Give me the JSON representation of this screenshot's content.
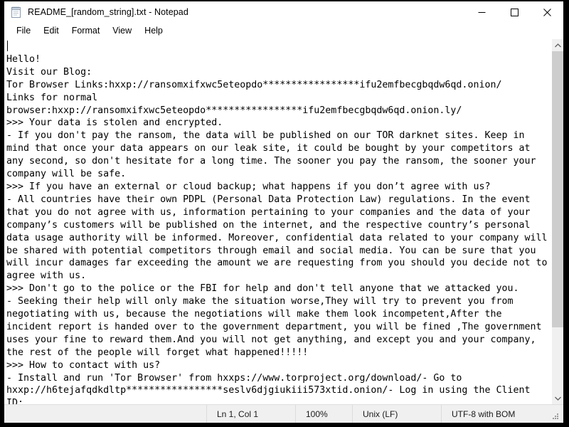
{
  "window": {
    "title": "README_[random_string].txt - Notepad",
    "icon": "notepad-icon",
    "controls": {
      "minimize": "minimize-icon",
      "maximize": "maximize-icon",
      "close": "close-icon"
    }
  },
  "menu": {
    "items": [
      {
        "label": "File"
      },
      {
        "label": "Edit"
      },
      {
        "label": "Format"
      },
      {
        "label": "View"
      },
      {
        "label": "Help"
      }
    ]
  },
  "editor": {
    "content": "\nHello!\nVisit our Blog:\nTor Browser Links:hxxp://ransomxifxwc5eteopdo*****************ifu2emfbecgbqdw6qd.onion/\nLinks for normal browser:hxxp://ransomxifxwc5eteopdo*****************ifu2emfbecgbqdw6qd.onion.ly/\n>>> Your data is stolen and encrypted.\n- If you don't pay the ransom, the data will be published on our TOR darknet sites. Keep in mind that once your data appears on our leak site, it could be bought by your competitors at any second, so don't hesitate for a long time. The sooner you pay the ransom, the sooner your company will be safe.\n>>> If you have an external or cloud backup; what happens if you don’t agree with us?\n- All countries have their own PDPL (Personal Data Protection Law) regulations. In the event that you do not agree with us, information pertaining to your companies and the data of your company’s customers will be published on the internet, and the respective country’s personal data usage authority will be informed. Moreover, confidential data related to your company will be shared with potential competitors through email and social media. You can be sure that you will incur damages far exceeding the amount we are requesting from you should you decide not to agree with us.\n>>> Don't go to the police or the FBI for help and don't tell anyone that we attacked you.\n- Seeking their help will only make the situation worse,They will try to prevent you from negotiating with us, because the negotiations will make them look incompetent,After the incident report is handed over to the government department, you will be fined ,The government uses your fine to reward them.And you will not get anything, and except you and your company, the rest of the people will forget what happened!!!!!\n>>> How to contact with us?\n- Install and run 'Tor Browser' from hxxps://www.torproject.org/download/- Go to hxxp://h6tejafqdkdltp*****************seslv6djgiukiii573xtid.onion/- Log in using the Client ID:\n-"
  },
  "scrollbar": {
    "up_arrow": "chevron-up-icon",
    "down_arrow": "chevron-down-icon",
    "thumb_position_percent": 0,
    "thumb_size_percent": 81
  },
  "statusbar": {
    "position": "Ln 1, Col 1",
    "zoom": "100%",
    "line_ending": "Unix (LF)",
    "encoding": "UTF-8 with BOM",
    "grip": "resize-grip-icon"
  },
  "colors": {
    "window_bg": "#ffffff",
    "desktop_bg": "#000000",
    "statusbar_bg": "#f0f0f0",
    "scroll_thumb": "#cdcdcd",
    "text": "#000000"
  }
}
